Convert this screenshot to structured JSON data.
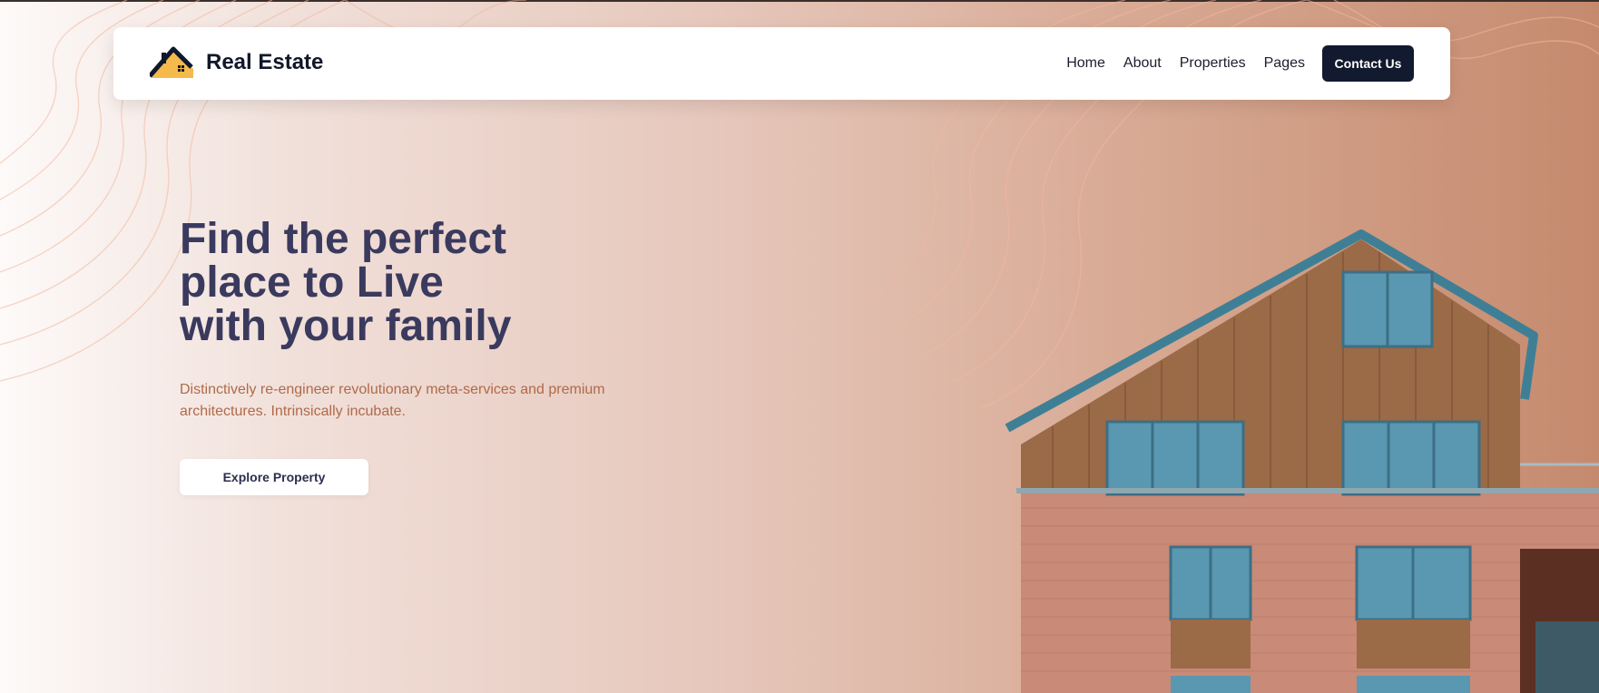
{
  "brand": {
    "name": "Real Estate",
    "logo": "house-logo-icon"
  },
  "nav": {
    "items": [
      {
        "label": "Home"
      },
      {
        "label": "About"
      },
      {
        "label": "Properties"
      },
      {
        "label": "Pages"
      }
    ],
    "cta": "Contact Us"
  },
  "hero": {
    "title_lines": [
      "Find the perfect",
      "place to Live",
      "with your family"
    ],
    "description": "Distinctively re-engineer revolutionary meta-services and premium architectures. Intrinsically incubate.",
    "button": "Explore Property",
    "image": "house-building-illustration"
  },
  "colors": {
    "primary_dark": "#111a2e",
    "heading": "#3a3a5e",
    "accent_text": "#b06a4a",
    "logo_yellow": "#f6b94c"
  }
}
